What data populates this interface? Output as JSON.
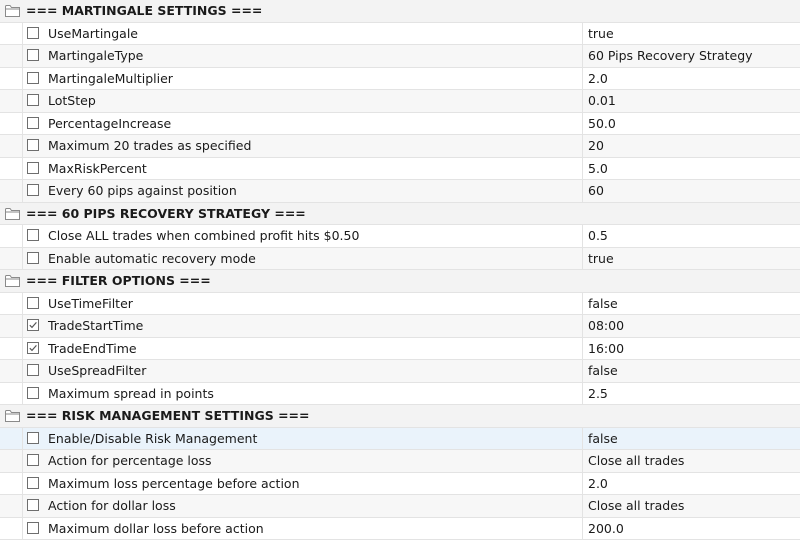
{
  "sections": [
    {
      "title": "=== MARTINGALE SETTINGS ===",
      "params": [
        {
          "name": "UseMartingale",
          "value": "true",
          "checked": false
        },
        {
          "name": "MartingaleType",
          "value": "60 Pips Recovery Strategy",
          "checked": false
        },
        {
          "name": "MartingaleMultiplier",
          "value": "2.0",
          "checked": false
        },
        {
          "name": "LotStep",
          "value": "0.01",
          "checked": false
        },
        {
          "name": "PercentageIncrease",
          "value": "50.0",
          "checked": false
        },
        {
          "name": "Maximum 20 trades as specified",
          "value": "20",
          "checked": false
        },
        {
          "name": "MaxRiskPercent",
          "value": "5.0",
          "checked": false
        },
        {
          "name": "Every 60 pips against position",
          "value": "60",
          "checked": false
        }
      ]
    },
    {
      "title": "=== 60 PIPS RECOVERY STRATEGY ===",
      "params": [
        {
          "name": "Close ALL trades when combined profit hits $0.50",
          "value": "0.5",
          "checked": false
        },
        {
          "name": "Enable automatic recovery mode",
          "value": "true",
          "checked": false
        }
      ]
    },
    {
      "title": "=== FILTER OPTIONS ===",
      "params": [
        {
          "name": "UseTimeFilter",
          "value": "false",
          "checked": false
        },
        {
          "name": "TradeStartTime",
          "value": "08:00",
          "checked": true
        },
        {
          "name": "TradeEndTime",
          "value": "16:00",
          "checked": true
        },
        {
          "name": "UseSpreadFilter",
          "value": "false",
          "checked": false
        },
        {
          "name": "Maximum spread in points",
          "value": "2.5",
          "checked": false
        }
      ]
    },
    {
      "title": "=== RISK MANAGEMENT SETTINGS ===",
      "params": [
        {
          "name": "Enable/Disable Risk Management",
          "value": "false",
          "checked": false,
          "selected": true
        },
        {
          "name": "Action for percentage loss",
          "value": "Close all trades",
          "checked": false
        },
        {
          "name": "Maximum loss percentage before action",
          "value": "2.0",
          "checked": false
        },
        {
          "name": "Action for dollar loss",
          "value": "Close all trades",
          "checked": false
        },
        {
          "name": "Maximum dollar loss before action",
          "value": "200.0",
          "checked": false
        }
      ]
    }
  ],
  "icons": {
    "section": "folder-icon",
    "param": "checkbox-icon"
  },
  "colors": {
    "selected_row": "#eaf3fb",
    "alt_row": "#f7f7f7",
    "section_row": "#f3f3f3"
  }
}
